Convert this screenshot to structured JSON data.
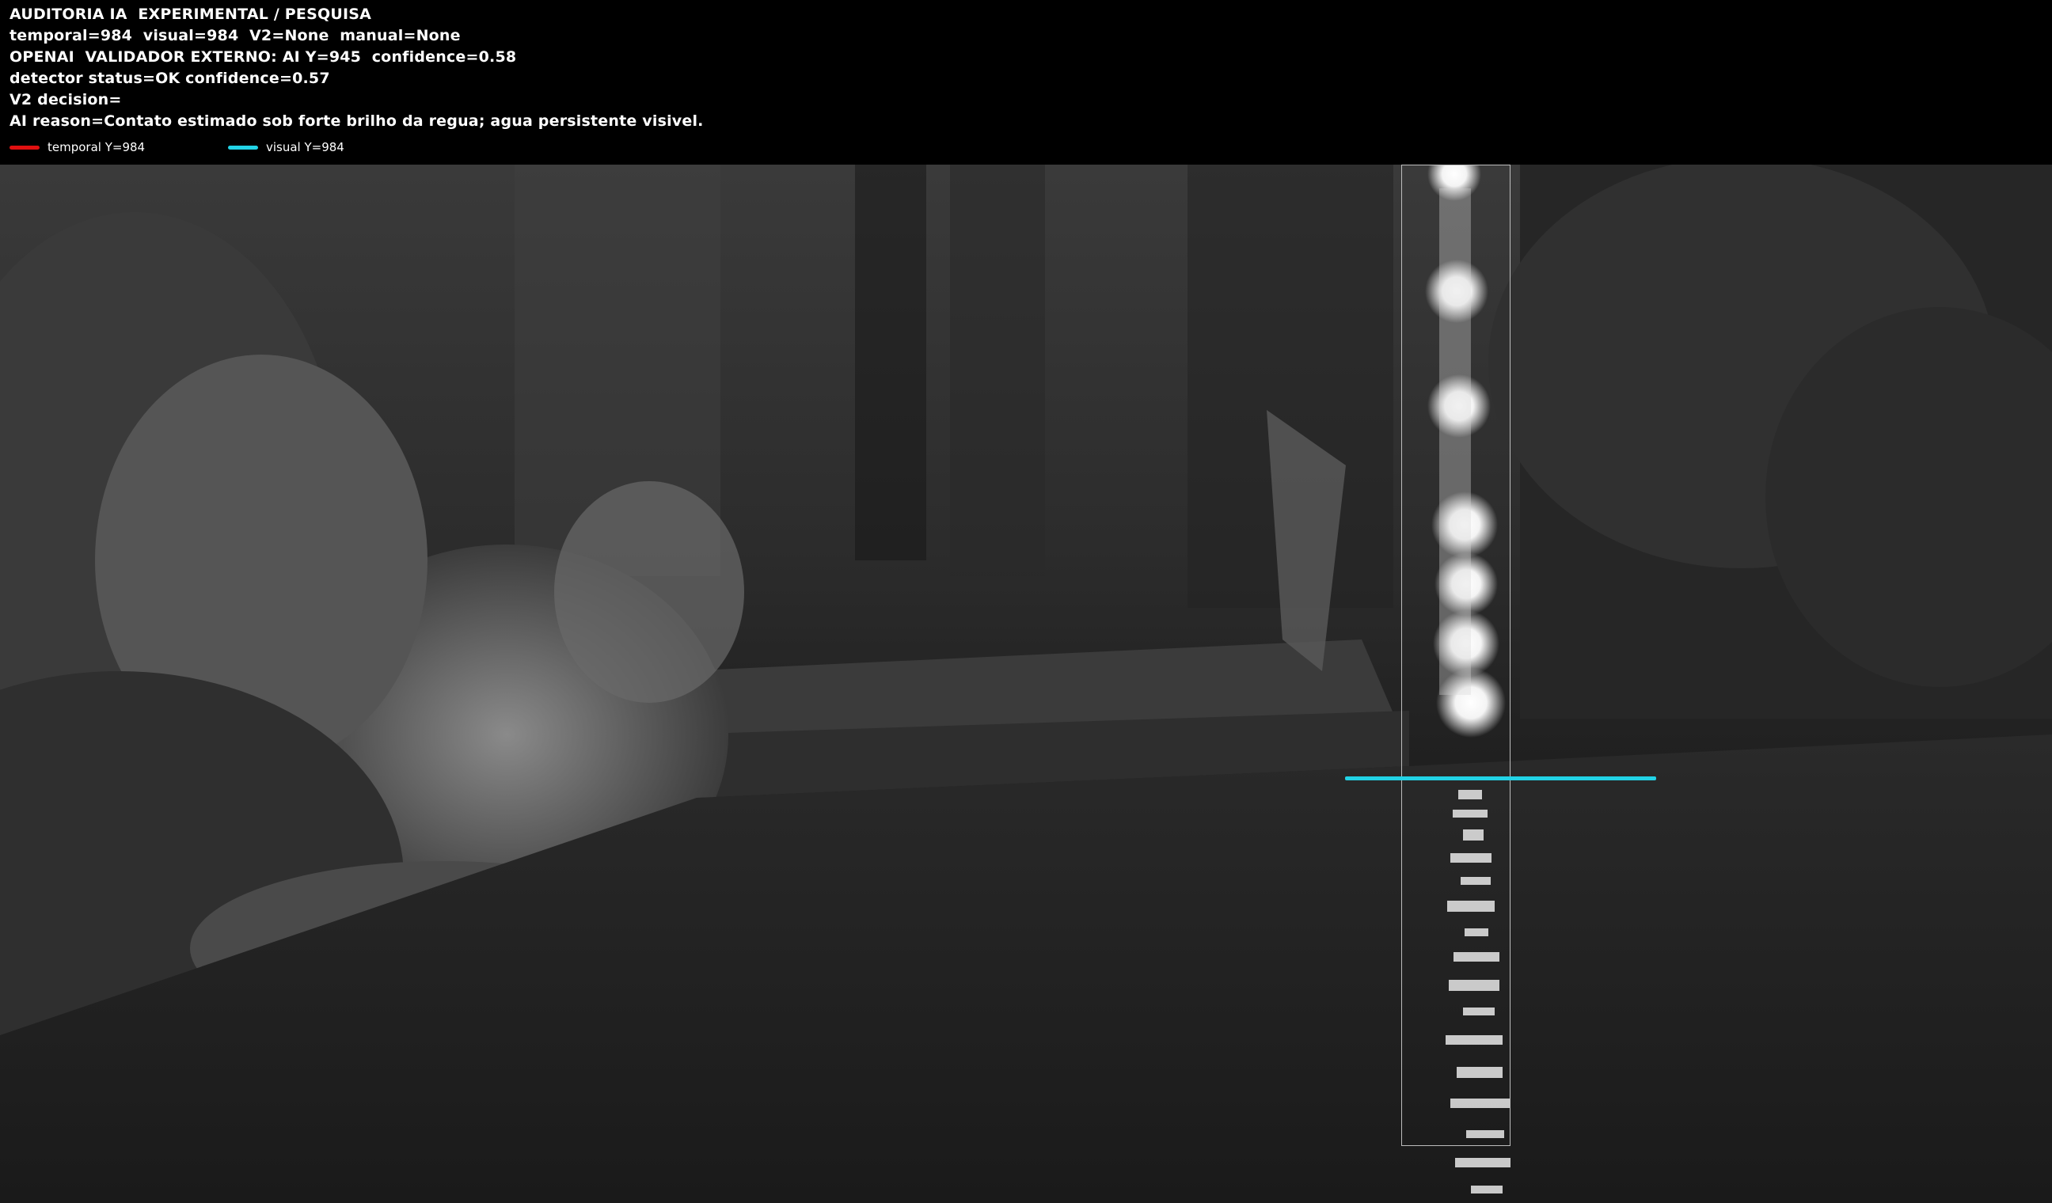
{
  "overlay": {
    "title": "AUDITORIA IA  EXPERIMENTAL / PESQUISA",
    "line_values": "temporal=984  visual=984  V2=None  manual=None",
    "line_openai": "OPENAI  VALIDADOR EXTERNO: AI Y=945  confidence=0.58",
    "line_detector": "detector status=OK confidence=0.57",
    "line_decision": "V2 decision=",
    "line_reason": "AI reason=Contato estimado sob forte brilho da regua; agua persistente visivel."
  },
  "legend": {
    "temporal_label": "temporal Y=984",
    "visual_label": "visual Y=984",
    "temporal_color": "#e01010",
    "visual_color": "#22d3e6"
  },
  "scene": {
    "description_icon": "night-infrared-river-camera-frame"
  }
}
